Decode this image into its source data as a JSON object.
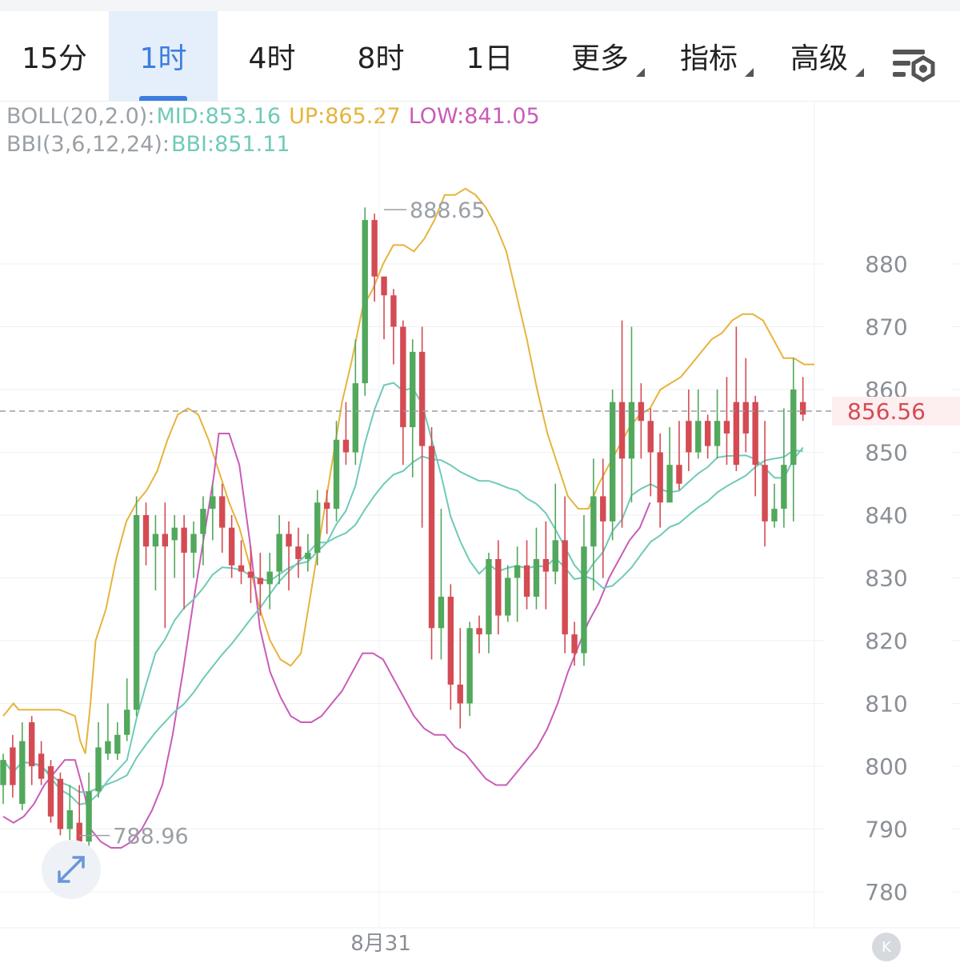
{
  "tabs": [
    {
      "label": "15分",
      "active": false,
      "dropdown": false
    },
    {
      "label": "1时",
      "active": true,
      "dropdown": false
    },
    {
      "label": "4时",
      "active": false,
      "dropdown": false
    },
    {
      "label": "8时",
      "active": false,
      "dropdown": false
    },
    {
      "label": "1日",
      "active": false,
      "dropdown": false
    },
    {
      "label": "更多",
      "active": false,
      "dropdown": true
    },
    {
      "label": "指标",
      "active": false,
      "dropdown": true
    },
    {
      "label": "高级",
      "active": false,
      "dropdown": true
    }
  ],
  "settings_icon": "chart-settings-icon",
  "legend": {
    "boll_name": "BOLL(20,2.0):",
    "boll_mid": "MID:853.16",
    "boll_up": "UP:865.27",
    "boll_low": "LOW:841.05",
    "bbi_name": "BBI(3,6,12,24):",
    "bbi_value": "BBI:851.11"
  },
  "colors": {
    "up": "#52a85c",
    "down": "#d44b53",
    "mid": "#6fcab8",
    "upper": "#e6b43c",
    "lower": "#c95cb8",
    "bbi": "#6fcab8",
    "accent": "#3c7ee0",
    "price_tag": "#d44b53"
  },
  "expand_icon": "expand-arrows-icon",
  "k_button": "K",
  "chart_data": {
    "type": "candlestick",
    "y_ticks": [
      780,
      790,
      800,
      810,
      820,
      830,
      840,
      850,
      860,
      870,
      880
    ],
    "y_tick_labels": [
      "780",
      "790",
      "800",
      "810",
      "820",
      "830",
      "840",
      "850",
      "860",
      "870",
      "880"
    ],
    "ylim": [
      775,
      895
    ],
    "x_label": "8月31",
    "x_label_index": 39.5,
    "current_price": 856.56,
    "current_price_label": "856.56",
    "high_marker": {
      "value": 888.65,
      "label": "888.65",
      "index": 40
    },
    "low_marker": {
      "value": 788.96,
      "label": "788.96",
      "index": 8
    },
    "candles": [
      [
        797,
        801,
        794,
        802
      ],
      [
        803,
        797,
        795,
        805
      ],
      [
        794,
        804,
        793,
        807
      ],
      [
        807,
        800,
        797,
        808
      ],
      [
        802,
        798,
        797,
        804
      ],
      [
        800,
        792,
        791,
        801
      ],
      [
        798,
        790,
        789,
        799
      ],
      [
        790,
        793,
        786,
        797
      ],
      [
        791,
        788,
        785,
        797
      ],
      [
        788,
        796,
        787,
        799
      ],
      [
        796,
        803,
        795,
        807
      ],
      [
        802,
        804,
        801,
        810
      ],
      [
        802,
        805,
        801,
        807
      ],
      [
        805,
        809,
        804,
        814
      ],
      [
        809,
        840,
        808,
        843
      ],
      [
        840,
        835,
        832,
        842
      ],
      [
        835,
        837,
        828,
        840
      ],
      [
        837,
        835,
        822,
        842
      ],
      [
        836,
        838,
        830,
        840
      ],
      [
        838,
        834,
        825,
        840
      ],
      [
        834,
        837,
        830,
        839
      ],
      [
        837,
        841,
        832,
        843
      ],
      [
        841,
        843,
        836,
        845
      ],
      [
        843,
        838,
        834,
        845
      ],
      [
        838,
        832,
        830,
        840
      ],
      [
        832,
        831,
        829,
        836
      ],
      [
        831,
        830,
        826,
        835
      ],
      [
        830,
        829,
        824,
        834
      ],
      [
        829,
        831,
        825,
        834
      ],
      [
        831,
        837,
        829,
        840
      ],
      [
        837,
        835,
        828,
        839
      ],
      [
        835,
        833,
        830,
        838
      ],
      [
        833,
        834,
        831,
        837
      ],
      [
        834,
        842,
        832,
        844
      ],
      [
        842,
        841,
        837,
        844
      ],
      [
        841,
        852,
        839,
        855
      ],
      [
        852,
        850,
        848,
        858
      ],
      [
        850,
        861,
        848,
        868
      ],
      [
        861,
        887,
        859,
        889
      ],
      [
        887,
        878,
        874,
        888
      ],
      [
        878,
        875,
        868,
        876
      ],
      [
        875,
        870,
        864,
        876
      ],
      [
        870,
        854,
        848,
        871
      ],
      [
        854,
        866,
        846,
        868
      ],
      [
        866,
        851,
        838,
        870
      ],
      [
        851,
        822,
        817,
        854
      ],
      [
        822,
        827,
        817,
        841
      ],
      [
        827,
        813,
        809,
        829
      ],
      [
        813,
        810,
        806,
        822
      ],
      [
        810,
        822,
        808,
        823
      ],
      [
        822,
        821,
        818,
        824
      ],
      [
        821,
        833,
        818,
        834
      ],
      [
        833,
        824,
        821,
        836
      ],
      [
        824,
        830,
        823,
        832
      ],
      [
        830,
        832,
        823,
        835
      ],
      [
        832,
        827,
        825,
        836
      ],
      [
        827,
        833,
        825,
        838
      ],
      [
        833,
        831,
        825,
        839
      ],
      [
        831,
        836,
        829,
        845
      ],
      [
        836,
        821,
        818,
        843
      ],
      [
        821,
        818,
        816,
        823
      ],
      [
        818,
        835,
        816,
        840
      ],
      [
        835,
        843,
        828,
        849
      ],
      [
        843,
        839,
        830,
        849
      ],
      [
        839,
        858,
        836,
        860
      ],
      [
        858,
        849,
        838,
        871
      ],
      [
        849,
        858,
        842,
        870
      ],
      [
        858,
        855,
        849,
        861
      ],
      [
        855,
        850,
        843,
        857
      ],
      [
        850,
        842,
        838,
        853
      ],
      [
        842,
        848,
        847,
        854
      ],
      [
        848,
        845,
        844,
        855
      ],
      [
        855,
        850,
        847,
        860
      ],
      [
        850,
        855,
        849,
        860
      ],
      [
        855,
        851,
        849,
        856
      ],
      [
        851,
        855,
        849,
        860
      ],
      [
        855,
        853,
        848,
        862
      ],
      [
        858,
        848,
        847,
        870
      ],
      [
        858,
        853,
        850,
        865
      ],
      [
        858,
        848,
        843,
        859
      ],
      [
        848,
        839,
        835,
        855
      ],
      [
        839,
        841,
        838,
        845
      ],
      [
        841,
        848,
        838,
        857
      ],
      [
        848,
        860,
        839,
        865
      ],
      [
        858,
        856,
        855,
        862
      ]
    ],
    "boll_upper": [
      [
        0,
        808
      ],
      [
        1,
        809
      ],
      [
        2,
        810
      ],
      [
        3,
        809
      ],
      [
        5,
        809
      ],
      [
        8,
        809
      ],
      [
        11,
        809
      ],
      [
        14,
        808
      ],
      [
        15,
        804
      ],
      [
        16,
        802
      ],
      [
        17,
        810
      ],
      [
        18,
        820
      ],
      [
        20,
        825
      ],
      [
        22,
        833
      ],
      [
        24,
        839
      ],
      [
        26,
        842
      ],
      [
        28,
        844
      ],
      [
        30,
        847
      ],
      [
        32,
        852
      ],
      [
        34,
        856
      ],
      [
        36,
        857
      ],
      [
        38,
        856
      ],
      [
        40,
        852
      ],
      [
        42,
        847
      ],
      [
        44,
        842
      ],
      [
        46,
        838
      ],
      [
        48,
        832
      ],
      [
        50,
        825
      ],
      [
        52,
        820
      ],
      [
        54,
        817
      ],
      [
        56,
        816
      ],
      [
        58,
        818
      ],
      [
        60,
        828
      ],
      [
        62,
        838
      ],
      [
        64,
        848
      ],
      [
        66,
        858
      ],
      [
        68,
        865
      ],
      [
        70,
        873
      ],
      [
        72,
        876
      ],
      [
        74,
        880
      ],
      [
        76,
        883
      ],
      [
        78,
        883
      ],
      [
        80,
        882
      ],
      [
        82,
        884
      ],
      [
        84,
        887
      ],
      [
        86,
        891
      ],
      [
        88,
        891
      ],
      [
        90,
        892
      ],
      [
        92,
        891
      ],
      [
        94,
        889
      ],
      [
        96,
        886
      ],
      [
        98,
        882
      ],
      [
        100,
        875
      ],
      [
        102,
        868
      ],
      [
        104,
        860
      ],
      [
        106,
        853
      ],
      [
        108,
        848
      ],
      [
        110,
        843
      ],
      [
        112,
        841
      ],
      [
        114,
        841
      ],
      [
        116,
        845
      ],
      [
        118,
        848
      ],
      [
        120,
        851
      ],
      [
        122,
        854
      ],
      [
        124,
        856
      ],
      [
        126,
        857
      ],
      [
        128,
        860
      ],
      [
        130,
        861
      ],
      [
        132,
        862
      ],
      [
        134,
        864
      ],
      [
        136,
        866
      ],
      [
        138,
        868
      ],
      [
        140,
        869
      ],
      [
        142,
        871
      ],
      [
        144,
        872
      ],
      [
        146,
        872
      ],
      [
        148,
        871
      ],
      [
        150,
        868
      ],
      [
        152,
        865
      ],
      [
        154,
        865
      ],
      [
        156,
        864
      ],
      [
        158,
        864
      ]
    ],
    "lines_note": "",
    "boll_lower": [
      [
        0,
        792
      ],
      [
        2,
        791
      ],
      [
        4,
        792
      ],
      [
        6,
        794
      ],
      [
        8,
        797
      ],
      [
        10,
        799
      ],
      [
        12,
        801
      ],
      [
        14,
        801
      ],
      [
        16,
        795
      ],
      [
        17,
        790
      ],
      [
        19,
        788
      ],
      [
        21,
        787
      ],
      [
        23,
        787
      ],
      [
        25,
        788
      ],
      [
        27,
        790
      ],
      [
        29,
        793
      ],
      [
        31,
        797
      ],
      [
        33,
        805
      ],
      [
        35,
        815
      ],
      [
        37,
        826
      ],
      [
        39,
        836
      ],
      [
        41,
        846
      ],
      [
        42,
        853
      ],
      [
        44,
        853
      ],
      [
        46,
        848
      ],
      [
        48,
        836
      ],
      [
        50,
        822
      ],
      [
        52,
        815
      ],
      [
        54,
        811
      ],
      [
        56,
        808
      ],
      [
        58,
        807
      ],
      [
        60,
        807
      ],
      [
        62,
        808
      ],
      [
        64,
        810
      ],
      [
        66,
        812
      ],
      [
        68,
        815
      ],
      [
        70,
        818
      ],
      [
        72,
        818
      ],
      [
        74,
        817
      ],
      [
        76,
        814
      ],
      [
        78,
        811
      ],
      [
        80,
        808
      ],
      [
        82,
        806
      ],
      [
        84,
        805
      ],
      [
        86,
        805
      ],
      [
        88,
        803
      ],
      [
        90,
        802
      ],
      [
        92,
        800
      ],
      [
        94,
        798
      ],
      [
        96,
        797
      ],
      [
        98,
        797
      ],
      [
        100,
        799
      ],
      [
        102,
        801
      ],
      [
        104,
        803
      ],
      [
        106,
        806
      ],
      [
        108,
        810
      ],
      [
        110,
        815
      ],
      [
        112,
        819
      ],
      [
        114,
        823
      ],
      [
        116,
        826
      ],
      [
        118,
        830
      ],
      [
        120,
        833
      ],
      [
        122,
        836
      ],
      [
        124,
        838
      ],
      [
        126,
        842
      ]
    ]
  }
}
